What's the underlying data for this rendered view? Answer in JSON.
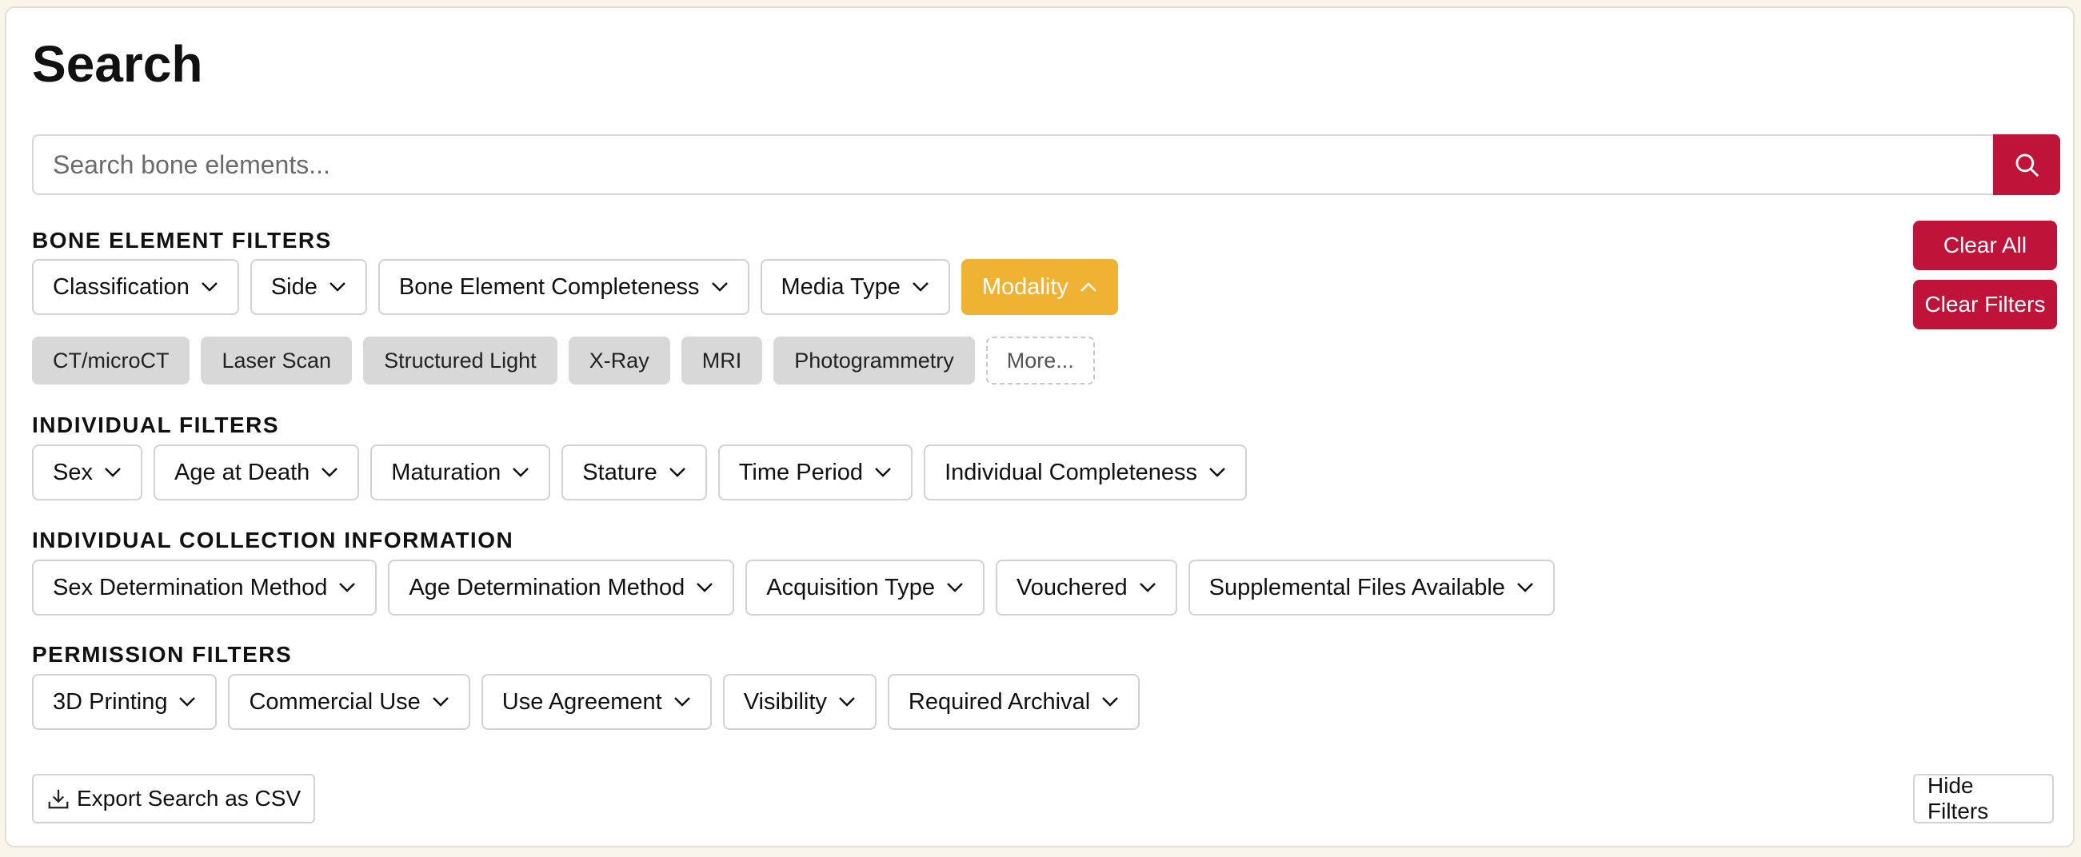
{
  "page": {
    "title": "Search"
  },
  "search": {
    "placeholder": "Search bone elements..."
  },
  "colors": {
    "accent_red": "#c0133a",
    "active_filter": "#f0b232",
    "chip_gray": "#d8d8d8"
  },
  "actions": {
    "clear_all": "Clear All",
    "clear_filters": "Clear Filters",
    "export": "Export Search as CSV",
    "hide_filters": "Hide Filters"
  },
  "bone_filters": {
    "heading": "BONE ELEMENT FILTERS",
    "dropdowns": [
      "Classification",
      "Side",
      "Bone Element Completeness",
      "Media Type",
      "Modality"
    ],
    "modality_options": [
      "CT/microCT",
      "Laser Scan",
      "Structured Light",
      "X-Ray",
      "MRI",
      "Photogrammetry"
    ],
    "more_label": "More..."
  },
  "individual_filters": {
    "heading": "INDIVIDUAL FILTERS",
    "dropdowns": [
      "Sex",
      "Age at Death",
      "Maturation",
      "Stature",
      "Time Period",
      "Individual Completeness"
    ]
  },
  "collection_info": {
    "heading": "INDIVIDUAL COLLECTION INFORMATION",
    "dropdowns": [
      "Sex Determination Method",
      "Age Determination Method",
      "Acquisition Type",
      "Vouchered",
      "Supplemental Files Available"
    ]
  },
  "permission_filters": {
    "heading": "PERMISSION FILTERS",
    "dropdowns": [
      "3D Printing",
      "Commercial Use",
      "Use Agreement",
      "Visibility",
      "Required Archival"
    ]
  }
}
